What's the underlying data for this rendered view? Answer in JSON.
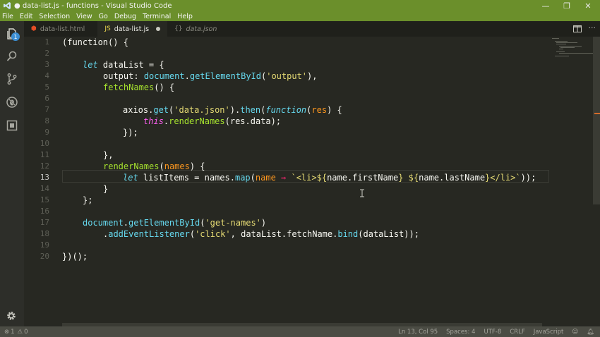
{
  "window": {
    "title": "● data-list.js - functions - Visual Studio Code",
    "controls": {
      "minimize": "—",
      "maximize": "❐",
      "close": "✕"
    }
  },
  "menu": [
    "File",
    "Edit",
    "Selection",
    "View",
    "Go",
    "Debug",
    "Terminal",
    "Help"
  ],
  "activity": {
    "explorer_badge": "1"
  },
  "tabs": [
    {
      "label": "data-list.html",
      "icon": "html5-icon",
      "color": "#e44d26"
    },
    {
      "label": "data-list.js",
      "icon": "js-icon",
      "color": "#f0db4f"
    },
    {
      "label": "data.json",
      "icon": "json-icon",
      "color": "#8a8a80"
    }
  ],
  "editor": {
    "line_numbers": [
      "1",
      "2",
      "3",
      "4",
      "5",
      "6",
      "7",
      "8",
      "9",
      "10",
      "11",
      "12",
      "13",
      "14",
      "15",
      "16",
      "17",
      "18",
      "19",
      "20"
    ],
    "current_line": "13",
    "code": {
      "l1": "(function() {",
      "l3_kw": "let",
      "l3_rest": " dataList = {",
      "l4_prop": "output",
      "l4_colon": ": ",
      "l4_obj": "document",
      "l4_dot": ".",
      "l4_fn": "getElementById",
      "l4_p1": "(",
      "l4_str": "'output'",
      "l4_p2": "),",
      "l5_fn": "fetchNames",
      "l5_rest": "() {",
      "l7_a": "axios",
      "l7_dot": ".",
      "l7_fn": "get",
      "l7_p1": "(",
      "l7_str": "'data.json'",
      "l7_p2": ").",
      "l7_fn2": "then",
      "l7_p3": "(",
      "l7_kw": "function",
      "l7_p4": "(",
      "l7_param": "res",
      "l7_p5": ") {",
      "l8_this": "this",
      "l8_dot": ".",
      "l8_fn": "renderNames",
      "l8_rest": "(res.data);",
      "l9": "});",
      "l11": "},",
      "l12_fn": "renderNames",
      "l12_p1": "(",
      "l12_param": "names",
      "l12_p2": ") {",
      "l13_kw": "let",
      "l13_a": " listItems = names.",
      "l13_fn": "map",
      "l13_p1": "(",
      "l13_param": "name",
      "l13_arrow": " ⇒ ",
      "l13_s1": "`<li>${",
      "l13_v1": "name.firstName",
      "l13_s2": "} ${",
      "l13_v2": "name.lastName",
      "l13_s3": "}</li>`",
      "l13_end": "));",
      "l14": "}",
      "l15": "};",
      "l17_obj": "document",
      "l17_dot": ".",
      "l17_fn": "getElementById",
      "l17_p1": "(",
      "l17_str": "'get-names'",
      "l17_p2": ")",
      "l18_dot": ".",
      "l18_fn": "addEventListener",
      "l18_p1": "(",
      "l18_str": "'click'",
      "l18_mid": ", dataList.fetchName.",
      "l18_fn2": "bind",
      "l18_end": "(dataList));",
      "l20": "})();"
    }
  },
  "status": {
    "errors": "1",
    "warnings": "0",
    "position": "Ln 13, Col 95",
    "spaces": "Spaces: 4",
    "encoding": "UTF-8",
    "eol": "CRLF",
    "language": "JavaScript"
  }
}
